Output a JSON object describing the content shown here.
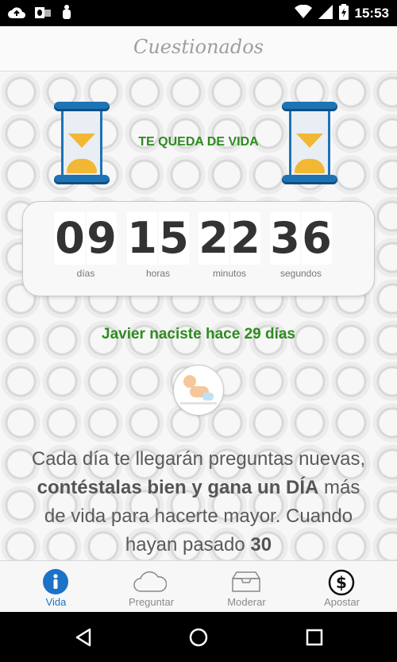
{
  "status_bar": {
    "time": "15:53",
    "left_icons": [
      "cloud-upload-icon",
      "outlook-icon",
      "android-debug-icon"
    ],
    "right_icons": [
      "wifi-icon",
      "signal-icon",
      "battery-charging-icon"
    ]
  },
  "app": {
    "title": "Cuestionados"
  },
  "life": {
    "label": "TE QUEDA DE VIDA",
    "units": [
      {
        "digits": [
          "0",
          "9"
        ],
        "label": "días"
      },
      {
        "digits": [
          "1",
          "5"
        ],
        "label": "horas"
      },
      {
        "digits": [
          "2",
          "2"
        ],
        "label": "minutos"
      },
      {
        "digits": [
          "3",
          "6"
        ],
        "label": "segundos"
      }
    ]
  },
  "born_text": "Javier naciste hace 29 días",
  "description": {
    "part1": "Cada día te llegarán preguntas nuevas, ",
    "bold1": "contéstalas bien y gana un DÍA",
    "part2": " más de vida para hacerte mayor. Cuando hayan pasado ",
    "bold2": "30"
  },
  "tabs": [
    {
      "label": "Vida",
      "icon": "info-icon",
      "active": true
    },
    {
      "label": "Preguntar",
      "icon": "cloud-icon",
      "active": false
    },
    {
      "label": "Moderar",
      "icon": "inbox-icon",
      "active": false
    },
    {
      "label": "Apostar",
      "icon": "dollar-icon",
      "active": false
    }
  ],
  "colors": {
    "accent_green": "#2e8b1f",
    "active_tab_blue": "#1a73c7",
    "hourglass_blue": "#1e73b5",
    "sand_yellow": "#f2b733"
  }
}
